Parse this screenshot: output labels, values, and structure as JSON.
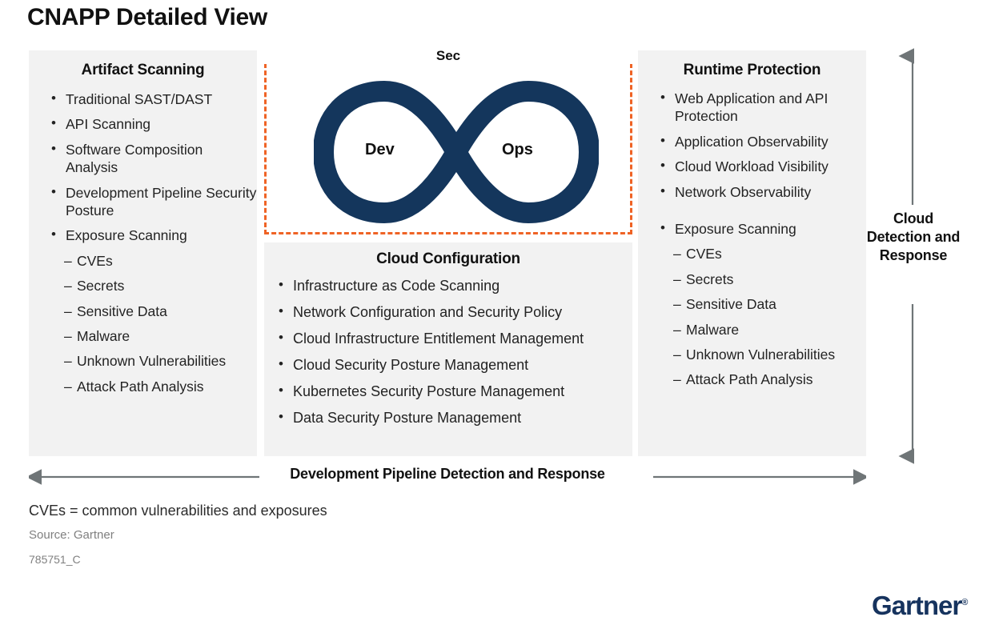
{
  "title": "CNAPP Detailed View",
  "panels": {
    "artifact": {
      "title": "Artifact Scanning",
      "items": [
        {
          "level": 1,
          "text": "Traditional SAST/DAST"
        },
        {
          "level": 1,
          "text": "API Scanning"
        },
        {
          "level": 1,
          "text": "Software Composition Analysis"
        },
        {
          "level": 1,
          "text": "Development Pipeline Security Posture"
        },
        {
          "level": 1,
          "text": "Exposure Scanning"
        },
        {
          "level": 2,
          "text": "CVEs"
        },
        {
          "level": 2,
          "text": "Secrets"
        },
        {
          "level": 2,
          "text": "Sensitive Data"
        },
        {
          "level": 2,
          "text": "Malware"
        },
        {
          "level": 2,
          "text": "Unknown Vulnerabilities"
        },
        {
          "level": 2,
          "text": "Attack Path Analysis"
        }
      ]
    },
    "cloud_configuration": {
      "title": "Cloud Configuration",
      "items": [
        {
          "level": 1,
          "text": "Infrastructure as Code Scanning"
        },
        {
          "level": 1,
          "text": "Network Configuration and Security Policy"
        },
        {
          "level": 1,
          "text": "Cloud Infrastructure Entitlement Management"
        },
        {
          "level": 1,
          "text": "Cloud Security Posture Management"
        },
        {
          "level": 1,
          "text": "Kubernetes Security Posture Management"
        },
        {
          "level": 1,
          "text": "Data Security Posture Management"
        }
      ]
    },
    "runtime": {
      "title": "Runtime Protection",
      "items": [
        {
          "level": 1,
          "text": "Web Application and API Protection"
        },
        {
          "level": 1,
          "text": "Application Observability"
        },
        {
          "level": 1,
          "text": "Cloud Workload Visibility"
        },
        {
          "level": 1,
          "text": "Network Observability"
        },
        {
          "level": 1,
          "text": "Exposure Scanning",
          "gap_before": true
        },
        {
          "level": 2,
          "text": "CVEs"
        },
        {
          "level": 2,
          "text": "Secrets"
        },
        {
          "level": 2,
          "text": "Sensitive Data"
        },
        {
          "level": 2,
          "text": "Malware"
        },
        {
          "level": 2,
          "text": "Unknown Vulnerabilities"
        },
        {
          "level": 2,
          "text": "Attack Path Analysis"
        }
      ]
    }
  },
  "center": {
    "sec_label": "Sec",
    "dev_label": "Dev",
    "ops_label": "Ops"
  },
  "arrows": {
    "horizontal_label": "Development Pipeline Detection and Response",
    "vertical_label": "Cloud Detection and Response"
  },
  "footnotes": {
    "cve": "CVEs = common vulnerabilities and exposures",
    "source": "Source: Gartner",
    "id": "785751_C"
  },
  "logo": {
    "text": "Gartner",
    "trademark": "®"
  },
  "colors": {
    "panel_background": "#f2f2f2",
    "dashed_border": "#ef6325",
    "infinity": "#14365c",
    "arrow": "#6f7577",
    "logo": "#16335e",
    "muted_text": "#808080"
  }
}
